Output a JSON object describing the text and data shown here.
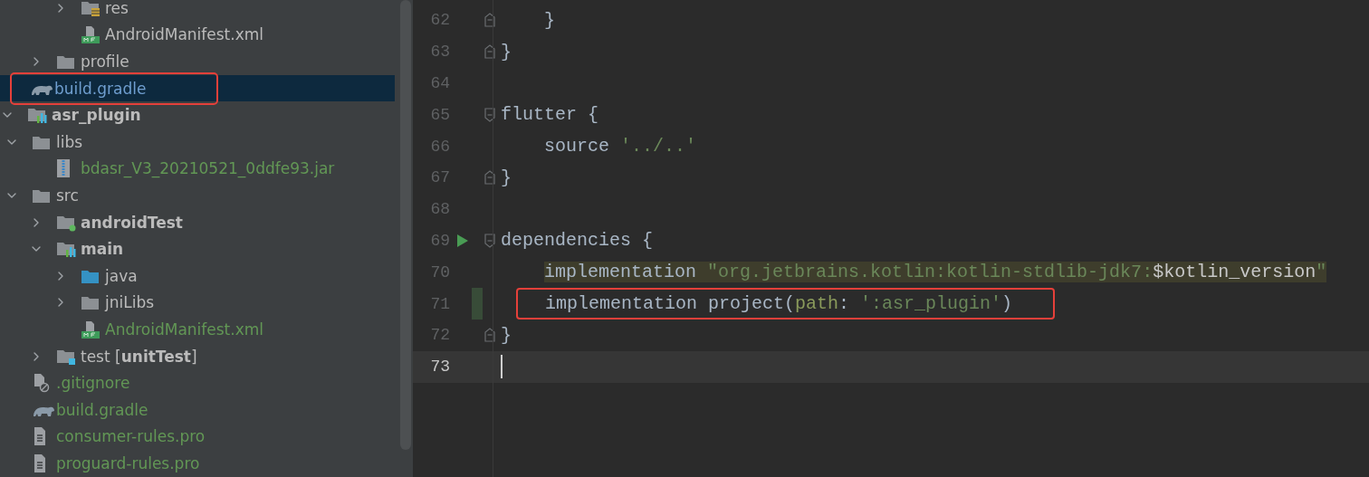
{
  "project_tree": [
    {
      "children": [
        {
          "children": [
            {
              "children": [
                {
                  "label": "res",
                  "kind": "res-folder",
                  "expanded": false,
                  "selected": false,
                  "bold": false,
                  "color": "#bbbbbb",
                  "annotated": false
                },
                {
                  "label": "AndroidManifest.xml",
                  "kind": "manifest",
                  "selected": false,
                  "bold": false,
                  "color": "#bbbbbb",
                  "annotated": false
                }
              ]
            },
            {
              "label": "profile",
              "kind": "folder",
              "expanded": false,
              "selected": false,
              "bold": false,
              "color": "#bbbbbb",
              "annotated": false
            }
          ]
        },
        {
          "label": "build.gradle",
          "kind": "gradle",
          "selected": true,
          "bold": false,
          "color": "#6f9ecf",
          "annotated": true
        }
      ]
    },
    {
      "label": "asr_plugin",
      "kind": "module",
      "expanded": true,
      "selected": false,
      "bold": true,
      "color": "#bbbbbb",
      "annotated": false,
      "children": [
        {
          "label": "libs",
          "kind": "folder",
          "expanded": true,
          "selected": false,
          "bold": false,
          "color": "#bbbbbb",
          "annotated": false,
          "children": [
            {
              "label": "bdasr_V3_20210521_0ddfe93.jar",
              "kind": "jar",
              "selected": false,
              "bold": false,
              "color": "#629755",
              "annotated": false
            }
          ]
        },
        {
          "label": "src",
          "kind": "folder",
          "expanded": true,
          "selected": false,
          "bold": false,
          "color": "#bbbbbb",
          "annotated": false,
          "children": [
            {
              "label": "androidTest",
              "kind": "test-folder",
              "expanded": false,
              "selected": false,
              "bold": true,
              "color": "#bbbbbb",
              "annotated": false
            },
            {
              "label": "main",
              "kind": "module",
              "expanded": true,
              "selected": false,
              "bold": true,
              "color": "#bbbbbb",
              "annotated": false,
              "children": [
                {
                  "label": "java",
                  "kind": "source-folder",
                  "expanded": false,
                  "selected": false,
                  "bold": false,
                  "color": "#bbbbbb",
                  "annotated": false
                },
                {
                  "label": "jniLibs",
                  "kind": "folder",
                  "expanded": false,
                  "selected": false,
                  "bold": false,
                  "color": "#bbbbbb",
                  "annotated": false
                },
                {
                  "label": "AndroidManifest.xml",
                  "kind": "manifest",
                  "selected": false,
                  "bold": false,
                  "color": "#629755",
                  "annotated": false
                }
              ]
            },
            {
              "label": "test [**unitTest**]",
              "kind": "unit-test-folder",
              "expanded": false,
              "selected": false,
              "bold": false,
              "color": "#bbbbbb",
              "annotated": false
            }
          ]
        },
        {
          "label": ".gitignore",
          "kind": "ignore-file",
          "selected": false,
          "bold": false,
          "color": "#629755",
          "annotated": false
        },
        {
          "label": "build.gradle",
          "kind": "gradle",
          "selected": false,
          "bold": false,
          "color": "#629755",
          "annotated": false
        },
        {
          "label": "consumer-rules.pro",
          "kind": "text-file",
          "selected": false,
          "bold": false,
          "color": "#629755",
          "annotated": false
        },
        {
          "label": "proguard-rules.pro",
          "kind": "text-file",
          "selected": false,
          "bold": false,
          "color": "#629755",
          "annotated": false
        }
      ]
    }
  ],
  "editor": {
    "lines": [
      {
        "number": "62",
        "fold_start": false,
        "fold_end": true,
        "run": false,
        "changed": false,
        "annotated": false,
        "highlighted": false,
        "current": false,
        "tokens": [
          {
            "kind": "plain",
            "text": "    }"
          }
        ]
      },
      {
        "number": "63",
        "fold_start": false,
        "fold_end": true,
        "run": false,
        "changed": false,
        "annotated": false,
        "highlighted": false,
        "current": false,
        "tokens": [
          {
            "kind": "plain",
            "text": "}"
          }
        ]
      },
      {
        "number": "64",
        "fold_start": false,
        "fold_end": false,
        "run": false,
        "changed": false,
        "annotated": false,
        "highlighted": false,
        "current": false
      },
      {
        "number": "65",
        "fold_start": true,
        "fold_end": false,
        "run": false,
        "changed": false,
        "annotated": false,
        "highlighted": false,
        "current": false,
        "tokens": [
          {
            "kind": "plain",
            "text": "flutter {"
          }
        ]
      },
      {
        "number": "66",
        "fold_start": false,
        "fold_end": false,
        "run": false,
        "changed": false,
        "annotated": false,
        "highlighted": false,
        "current": false,
        "tokens": [
          {
            "kind": "plain",
            "text": "    source "
          },
          {
            "kind": "string",
            "text": "'../..'"
          }
        ]
      },
      {
        "number": "67",
        "fold_start": false,
        "fold_end": true,
        "run": false,
        "changed": false,
        "annotated": false,
        "highlighted": false,
        "current": false,
        "tokens": [
          {
            "kind": "plain",
            "text": "}"
          }
        ]
      },
      {
        "number": "68",
        "fold_start": false,
        "fold_end": false,
        "run": false,
        "changed": false,
        "annotated": false,
        "highlighted": false,
        "current": false
      },
      {
        "number": "69",
        "fold_start": true,
        "fold_end": false,
        "run": true,
        "changed": false,
        "annotated": false,
        "highlighted": false,
        "current": false,
        "tokens": [
          {
            "kind": "plain",
            "text": "dependencies {"
          }
        ]
      },
      {
        "number": "70",
        "fold_start": false,
        "fold_end": false,
        "run": false,
        "changed": false,
        "annotated": false,
        "highlighted": true,
        "current": false,
        "tokens": [
          {
            "kind": "plain",
            "text": "    implementation "
          },
          {
            "kind": "string",
            "text": "\"org.jetbrains.kotlin:kotlin-stdlib-jdk7:"
          },
          {
            "kind": "variable",
            "text": "$kotlin_version"
          },
          {
            "kind": "string",
            "text": "\""
          }
        ]
      },
      {
        "number": "71",
        "fold_start": false,
        "fold_end": false,
        "run": false,
        "changed": true,
        "annotated": true,
        "highlighted": false,
        "current": false,
        "tokens": [
          {
            "kind": "plain",
            "text": "implementation project("
          },
          {
            "kind": "named-arg",
            "text": "path"
          },
          {
            "kind": "plain",
            "text": ": "
          },
          {
            "kind": "string",
            "text": "':asr_plugin'"
          },
          {
            "kind": "plain",
            "text": ")"
          }
        ]
      },
      {
        "number": "72",
        "fold_start": false,
        "fold_end": true,
        "run": false,
        "changed": false,
        "annotated": false,
        "highlighted": false,
        "current": false,
        "tokens": [
          {
            "kind": "plain",
            "text": "}"
          }
        ]
      },
      {
        "number": "73",
        "fold_start": false,
        "fold_end": false,
        "run": false,
        "changed": false,
        "annotated": false,
        "highlighted": false,
        "current": true
      }
    ]
  }
}
